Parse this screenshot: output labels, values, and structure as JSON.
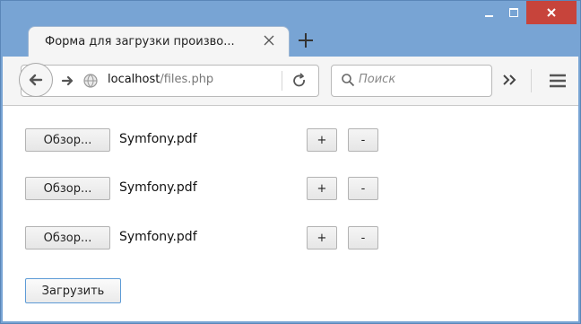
{
  "tab": {
    "title": "Форма для загрузки произво..."
  },
  "navbar": {
    "url_host": "localhost",
    "url_path": "/files.php",
    "search_placeholder": "Поиск"
  },
  "form": {
    "rows": [
      {
        "browse_label": "Обзор...",
        "filename": "Symfony.pdf",
        "add_label": "+",
        "remove_label": "-"
      },
      {
        "browse_label": "Обзор...",
        "filename": "Symfony.pdf",
        "add_label": "+",
        "remove_label": "-"
      },
      {
        "browse_label": "Обзор...",
        "filename": "Symfony.pdf",
        "add_label": "+",
        "remove_label": "-"
      }
    ],
    "submit_label": "Загрузить"
  },
  "icons": {
    "back": "back-arrow-icon",
    "forward": "forward-arrow-icon",
    "site": "globe-icon",
    "reload": "reload-icon",
    "search": "search-icon",
    "overflow": "double-chevron-icon",
    "menu": "hamburger-menu-icon",
    "tab_close": "close-icon",
    "new_tab": "plus-icon"
  },
  "colors": {
    "window_frame": "#78a4d4",
    "close_button": "#c7443b",
    "focus_border": "#5d9bd6"
  }
}
